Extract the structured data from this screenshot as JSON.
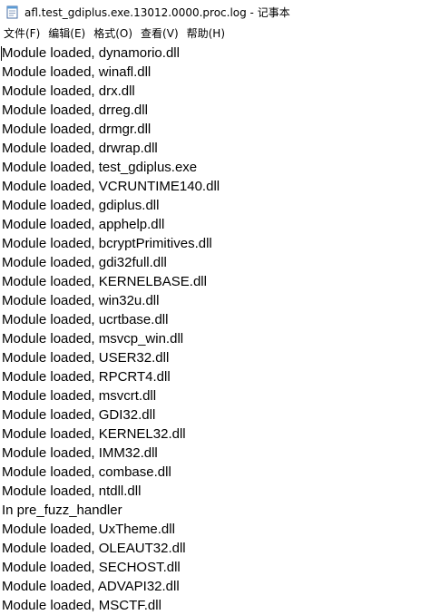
{
  "window": {
    "title": "afl.test_gdiplus.exe.13012.0000.proc.log - 记事本",
    "icon": "notepad-icon"
  },
  "menu": [
    {
      "label": "文件(F)"
    },
    {
      "label": "编辑(E)"
    },
    {
      "label": "格式(O)"
    },
    {
      "label": "查看(V)"
    },
    {
      "label": "帮助(H)"
    }
  ],
  "editor": {
    "lines": [
      "Module loaded, dynamorio.dll",
      "Module loaded, winafl.dll",
      "Module loaded, drx.dll",
      "Module loaded, drreg.dll",
      "Module loaded, drmgr.dll",
      "Module loaded, drwrap.dll",
      "Module loaded, test_gdiplus.exe",
      "Module loaded, VCRUNTIME140.dll",
      "Module loaded, gdiplus.dll",
      "Module loaded, apphelp.dll",
      "Module loaded, bcryptPrimitives.dll",
      "Module loaded, gdi32full.dll",
      "Module loaded, KERNELBASE.dll",
      "Module loaded, win32u.dll",
      "Module loaded, ucrtbase.dll",
      "Module loaded, msvcp_win.dll",
      "Module loaded, USER32.dll",
      "Module loaded, RPCRT4.dll",
      "Module loaded, msvcrt.dll",
      "Module loaded, GDI32.dll",
      "Module loaded, KERNEL32.dll",
      "Module loaded, IMM32.dll",
      "Module loaded, combase.dll",
      "Module loaded, ntdll.dll",
      "In pre_fuzz_handler",
      "Module loaded, UxTheme.dll",
      "Module loaded, OLEAUT32.dll",
      "Module loaded, SECHOST.dll",
      "Module loaded, ADVAPI32.dll",
      "Module loaded, MSCTF.dll"
    ]
  }
}
